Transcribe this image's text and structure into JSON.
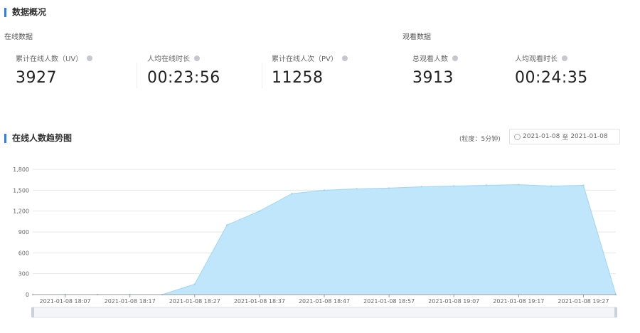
{
  "overview": {
    "title": "数据概况",
    "online_group_label": "在线数据",
    "watch_group_label": "观看数据",
    "stats": [
      {
        "label": "累计在线人数（UV）",
        "value": "3927"
      },
      {
        "label": "人均在线时长",
        "value": "00:23:56"
      },
      {
        "label": "累计在线人次（PV）",
        "value": "11258"
      },
      {
        "label": "总观看人数",
        "value": "3913"
      },
      {
        "label": "人均观看时长",
        "value": "00:24:35"
      }
    ]
  },
  "trend": {
    "title": "在线人数趋势图",
    "interval_label": "(粒度：5分钟)",
    "date_range": {
      "start": "2021-01-08",
      "sep": "至",
      "end": "2021-01-08"
    }
  },
  "colors": {
    "area_fill": "#bfe6fa",
    "area_line": "#9fd6f3",
    "accent": "#2f7df6",
    "grid": "#e6e6e6"
  },
  "chart_data": {
    "type": "area",
    "x": [
      "2021-01-08 18:02",
      "2021-01-08 18:07",
      "2021-01-08 18:12",
      "2021-01-08 18:17",
      "2021-01-08 18:22",
      "2021-01-08 18:27",
      "2021-01-08 18:32",
      "2021-01-08 18:37",
      "2021-01-08 18:42",
      "2021-01-08 18:47",
      "2021-01-08 18:52",
      "2021-01-08 18:57",
      "2021-01-08 19:02",
      "2021-01-08 19:07",
      "2021-01-08 19:12",
      "2021-01-08 19:17",
      "2021-01-08 19:22",
      "2021-01-08 19:27",
      "2021-01-08 19:32"
    ],
    "y": [
      0,
      0,
      0,
      0,
      0,
      150,
      1000,
      1200,
      1450,
      1500,
      1520,
      1530,
      1550,
      1560,
      1570,
      1580,
      1560,
      1570,
      0
    ],
    "xticks": [
      "2021-01-08 18:07",
      "2021-01-08 18:17",
      "2021-01-08 18:27",
      "2021-01-08 18:37",
      "2021-01-08 18:47",
      "2021-01-08 18:57",
      "2021-01-08 19:07",
      "2021-01-08 19:17",
      "2021-01-08 19:27"
    ],
    "yticks": [
      "0",
      "300",
      "600",
      "900",
      "1,200",
      "1,500",
      "1,800"
    ],
    "ylim": [
      0,
      1800
    ],
    "grid": true
  }
}
